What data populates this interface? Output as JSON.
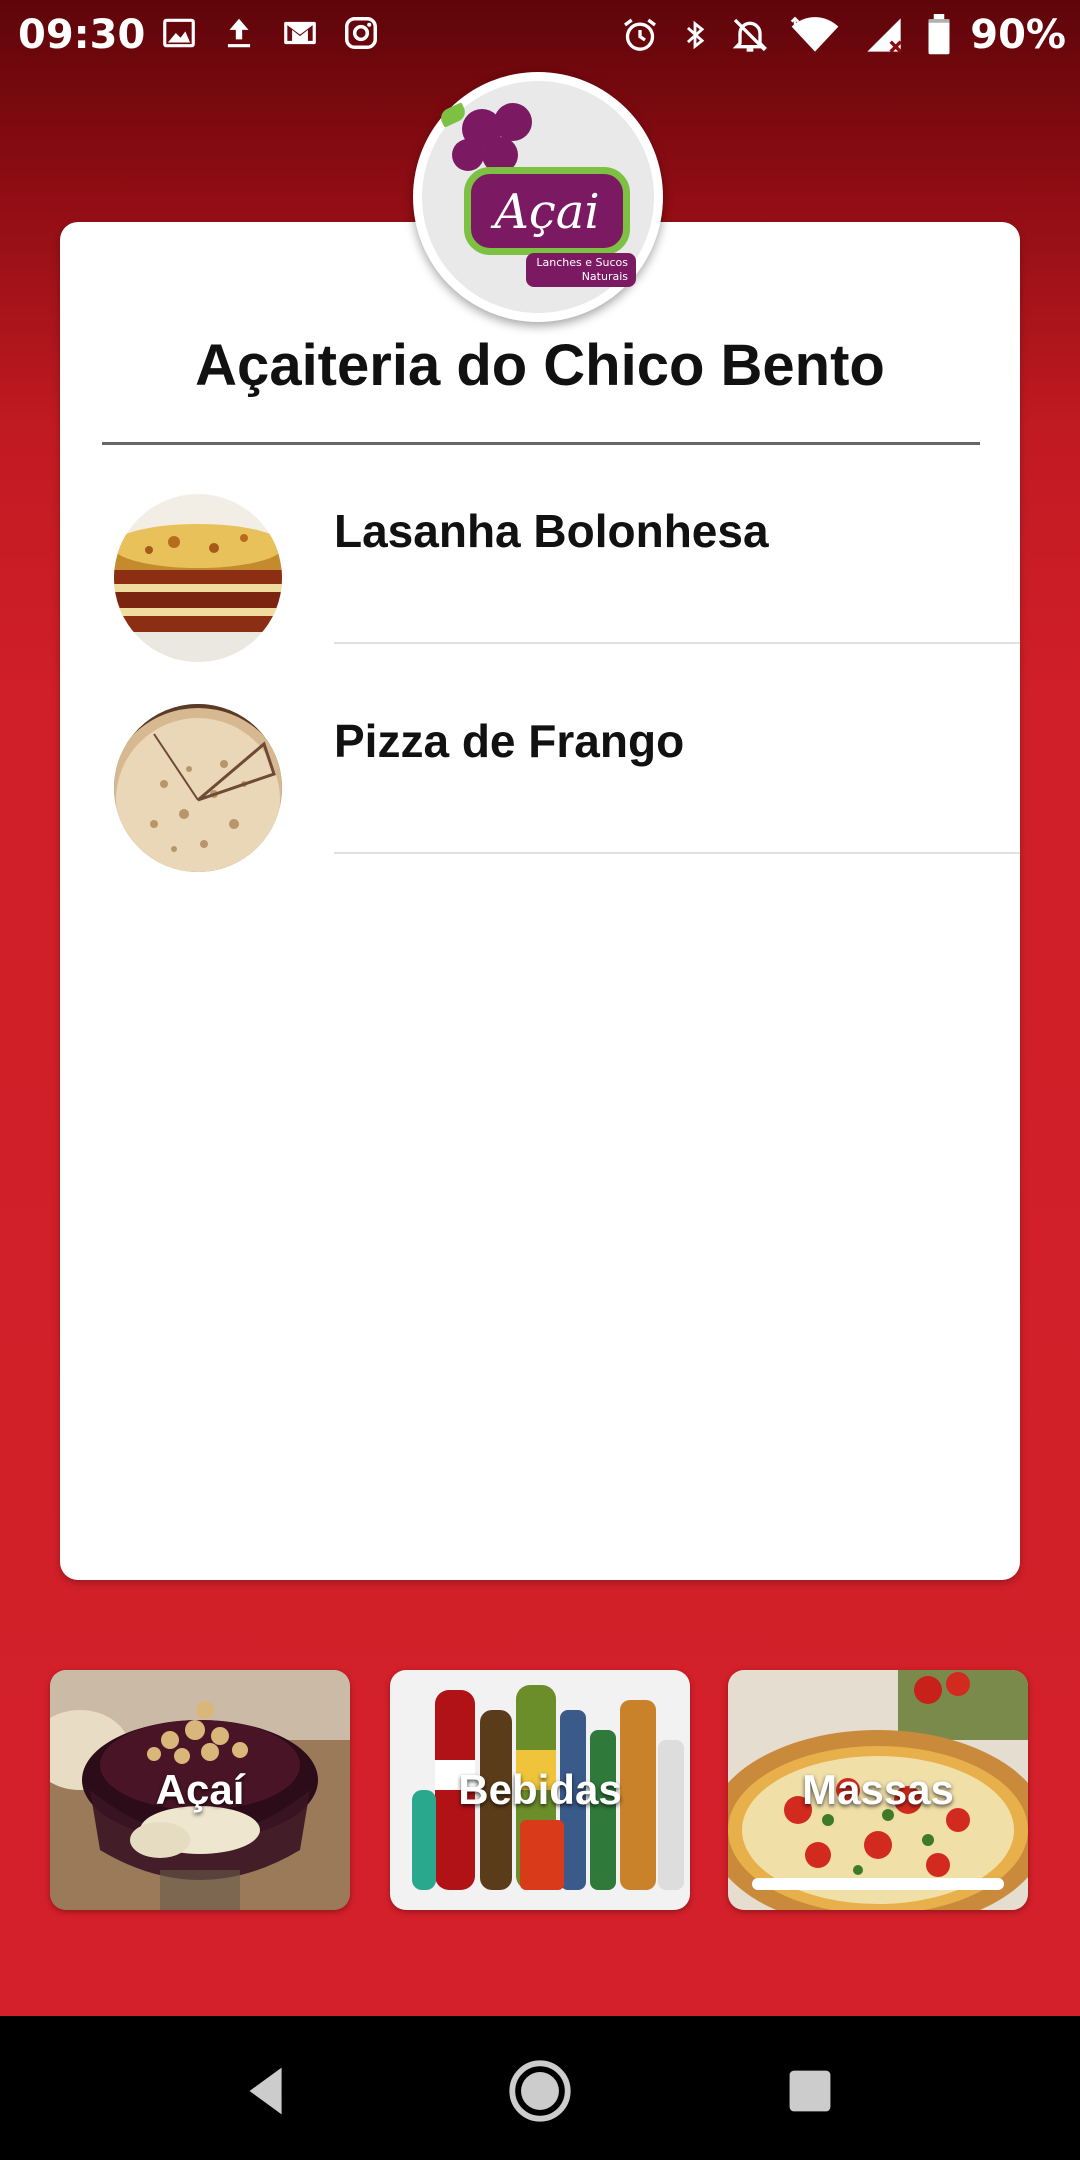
{
  "status_bar": {
    "time": "09:30",
    "left_icons": [
      "image-icon",
      "upload-icon",
      "gmail-icon",
      "instagram-icon"
    ],
    "right_icons": [
      "alarm-icon",
      "bluetooth-icon",
      "notifications-off-icon",
      "wifi-icon",
      "signal-icon",
      "battery-icon"
    ],
    "battery": "90%"
  },
  "logo": {
    "word": "Açai",
    "tagline": "Lanches e Sucos Naturais"
  },
  "card": {
    "title": "Açaiteria do Chico Bento",
    "items": [
      {
        "name": "Lasanha Bolonhesa",
        "photo": "lasagna-photo"
      },
      {
        "name": "Pizza de Frango",
        "photo": "chicken-pizza-photo"
      }
    ]
  },
  "categories": [
    {
      "label": "Açaí",
      "photo": "acai-bowl-photo",
      "selected": false
    },
    {
      "label": "Bebidas",
      "photo": "drinks-photo",
      "selected": false
    },
    {
      "label": "Massas",
      "photo": "pizza-photo",
      "selected": true
    }
  ],
  "nav": {
    "buttons": [
      "back-icon",
      "home-icon",
      "recents-icon"
    ]
  },
  "colors": {
    "background": "#d4202a",
    "background_top": "#5e050a",
    "logo_purple": "#7b1a63",
    "logo_green": "#7dc142"
  }
}
